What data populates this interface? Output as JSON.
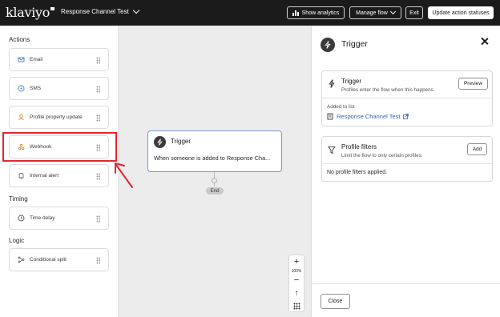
{
  "header": {
    "logo": "klaviyo",
    "flow_name": "Response Channel Test",
    "show_analytics": "Show analytics",
    "manage_flow": "Manage flow",
    "exit": "Exit",
    "update_statuses": "Update action statuses"
  },
  "sidebar": {
    "actions_title": "Actions",
    "timing_title": "Timing",
    "logic_title": "Logic",
    "actions": [
      {
        "label": "Email",
        "icon": "mail-icon"
      },
      {
        "label": "SMS",
        "icon": "sms-icon"
      },
      {
        "label": "Profile property update",
        "icon": "profile-icon"
      },
      {
        "label": "Webhook",
        "icon": "webhook-icon"
      },
      {
        "label": "Internal alert",
        "icon": "bell-icon"
      }
    ],
    "timing": [
      {
        "label": "Time delay",
        "icon": "clock-icon"
      }
    ],
    "logic": [
      {
        "label": "Conditional split",
        "icon": "split-icon"
      }
    ]
  },
  "canvas": {
    "trigger_title": "Trigger",
    "trigger_desc": "When someone is added to Response Cha...",
    "end_label": "End",
    "zoom_in": "+",
    "zoom_level": "100%",
    "zoom_out": "−",
    "fit": "↑"
  },
  "panel": {
    "title": "Trigger",
    "trigger_box": {
      "title": "Trigger",
      "subtitle": "Profiles enter the flow when this happens.",
      "button": "Preview",
      "added_label": "Added to list",
      "list_name": "Response Channel Test"
    },
    "filters_box": {
      "title": "Profile filters",
      "subtitle": "Limit the flow to only certain profiles.",
      "button": "Add",
      "empty": "No profile filters applied."
    },
    "close_button": "Close"
  },
  "colors": {
    "topbar": "#1b1b1b",
    "canvas": "#ececec",
    "highlight": "#e22630",
    "link": "#3566b5",
    "trigger_border": "#6f9ad6"
  }
}
